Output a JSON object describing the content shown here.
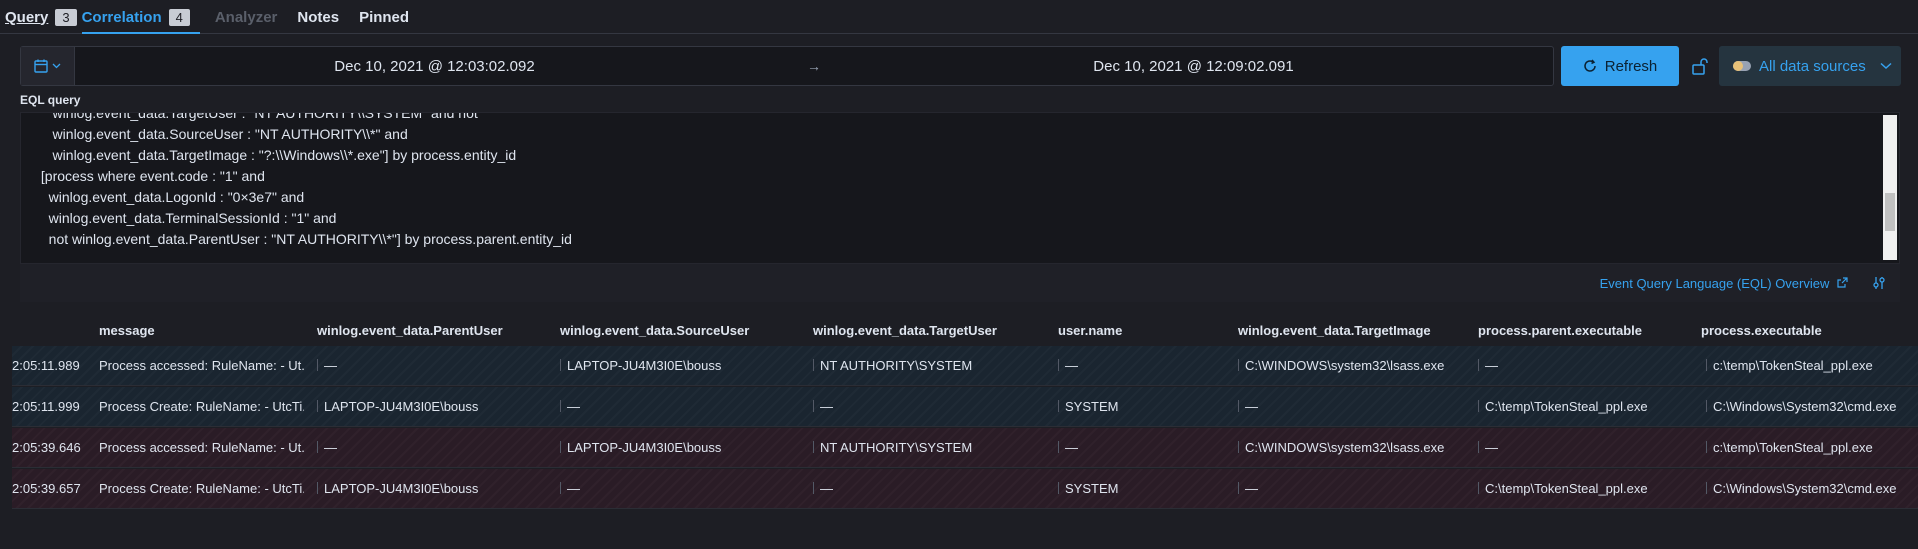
{
  "tabs": [
    {
      "label": "Query",
      "badge": "3"
    },
    {
      "label": "Correlation",
      "badge": "4"
    },
    {
      "label": "Analyzer"
    },
    {
      "label": "Notes"
    },
    {
      "label": "Pinned"
    }
  ],
  "datebar": {
    "start": "Dec 10, 2021 @ 12:03:02.092",
    "arrow": "→",
    "end": "Dec 10, 2021 @ 12:09:02.091"
  },
  "refresh_label": "Refresh",
  "datasources_label": "All data sources",
  "eql": {
    "label": "EQL query",
    "text": "    winlog.event_data.TargetUser : \"NT AUTHORITY\\\\SYSTEM\" and not\n    winlog.event_data.SourceUser : \"NT AUTHORITY\\\\*\" and\n    winlog.event_data.TargetImage : \"?:\\\\Windows\\\\*.exe\"] by process.entity_id\n [process where event.code : \"1\" and\n   winlog.event_data.LogonId : \"0×3e7\" and\n   winlog.event_data.TerminalSessionId : \"1\" and\n   not winlog.event_data.ParentUser : \"NT AUTHORITY\\\\*\"] by process.parent.entity_id",
    "link": "Event Query Language (EQL) Overview"
  },
  "table": {
    "columns": [
      "message",
      "winlog.event_data.ParentUser",
      "winlog.event_data.SourceUser",
      "winlog.event_data.TargetUser",
      "user.name",
      "winlog.event_data.TargetImage",
      "process.parent.executable",
      "process.executable"
    ],
    "rows": [
      {
        "time": "2:05:11.989",
        "message": "Process accessed: RuleName: - Ut...",
        "parent_user": "—",
        "source_user": "LAPTOP-JU4M3I0E\\bouss",
        "target_user": "NT AUTHORITY\\SYSTEM",
        "user_name": "—",
        "target_image": "C:\\WINDOWS\\system32\\lsass.exe",
        "parent_exe": "—",
        "exe": "c:\\temp\\TokenSteal_ppl.exe"
      },
      {
        "time": "2:05:11.999",
        "message": "Process Create: RuleName: - UtcTi...",
        "parent_user": "LAPTOP-JU4M3I0E\\bouss",
        "source_user": "—",
        "target_user": "—",
        "user_name": "SYSTEM",
        "target_image": "—",
        "parent_exe": "C:\\temp\\TokenSteal_ppl.exe",
        "exe": "C:\\Windows\\System32\\cmd.exe"
      },
      {
        "time": "2:05:39.646",
        "message": "Process accessed: RuleName: - Ut...",
        "parent_user": "—",
        "source_user": "LAPTOP-JU4M3I0E\\bouss",
        "target_user": "NT AUTHORITY\\SYSTEM",
        "user_name": "—",
        "target_image": "C:\\WINDOWS\\system32\\lsass.exe",
        "parent_exe": "—",
        "exe": "c:\\temp\\TokenSteal_ppl.exe"
      },
      {
        "time": "2:05:39.657",
        "message": "Process Create: RuleName: - UtcTi...",
        "parent_user": "LAPTOP-JU4M3I0E\\bouss",
        "source_user": "—",
        "target_user": "—",
        "user_name": "SYSTEM",
        "target_image": "—",
        "parent_exe": "C:\\temp\\TokenSteal_ppl.exe",
        "exe": "C:\\Windows\\System32\\cmd.exe"
      }
    ]
  },
  "colors": {
    "accent": "#36a2ef",
    "background": "#1d1e24"
  }
}
